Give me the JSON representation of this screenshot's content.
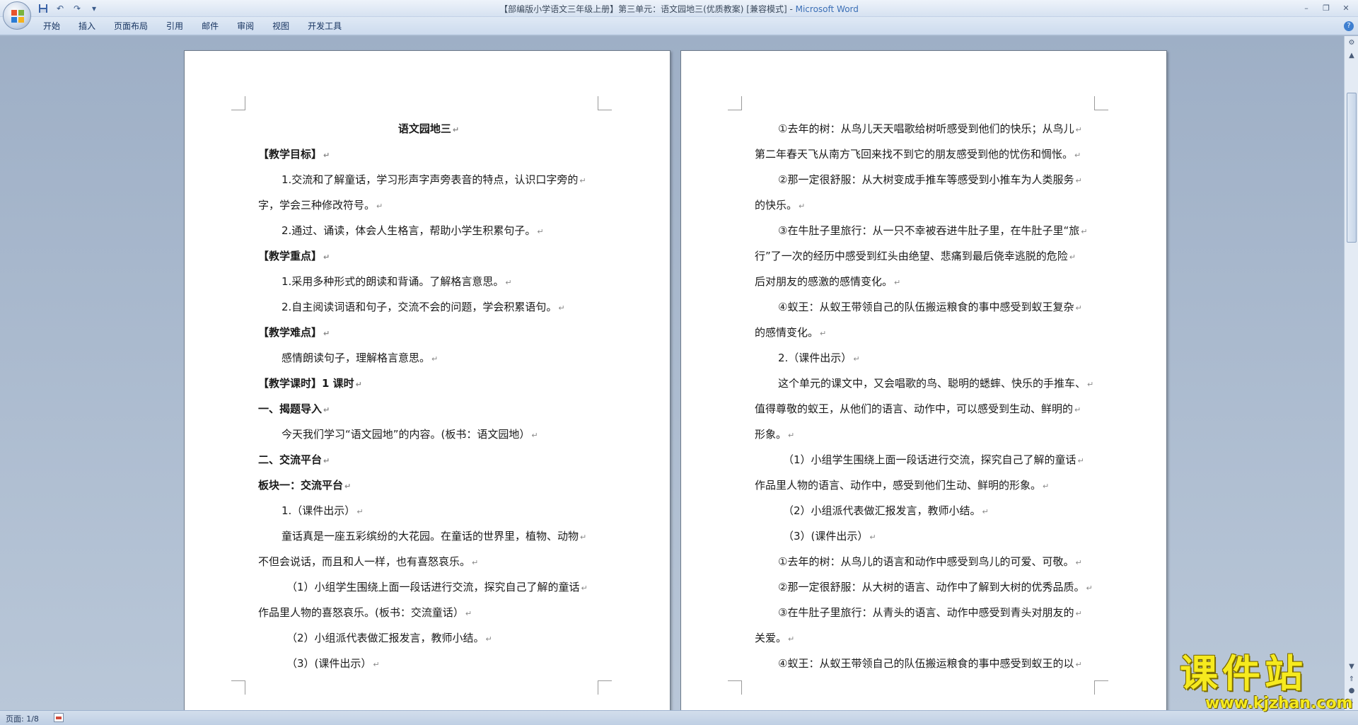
{
  "window": {
    "title_prefix": "【部编版小学语文三年级上册】第三单元：语文园地三(优质教案) [兼容模式] - ",
    "title_app": "Microsoft Word",
    "controls": [
      "minimize-icon",
      "restore-icon",
      "close-icon"
    ]
  },
  "quick_access": [
    "save-icon",
    "undo-icon",
    "redo-icon",
    "customize-icon"
  ],
  "ribbon": {
    "tabs": [
      "开始",
      "插入",
      "页面布局",
      "引用",
      "邮件",
      "审阅",
      "视图",
      "开发工具"
    ]
  },
  "pages": {
    "left": [
      {
        "text": "语文园地三",
        "style": "center bold"
      },
      {
        "text": "【教学目标】",
        "style": "bold"
      },
      {
        "text": "1.交流和了解童话，学习形声字声旁表音的特点，认识口字旁的",
        "style": "indent"
      },
      {
        "text": "字，学会三种修改符号。",
        "style": ""
      },
      {
        "text": "2.通过、诵读，体会人生格言，帮助小学生积累句子。",
        "style": "indent"
      },
      {
        "text": "【教学重点】",
        "style": "bold"
      },
      {
        "text": "1.采用多种形式的朗读和背诵。了解格言意思。",
        "style": "indent"
      },
      {
        "text": "2.自主阅读词语和句子，交流不会的问题，学会积累语句。",
        "style": "indent"
      },
      {
        "text": "【教学难点】",
        "style": "bold"
      },
      {
        "text": "感情朗读句子，理解格言意思。",
        "style": "indent"
      },
      {
        "text": "【教学课时】1 课时",
        "style": "bold"
      },
      {
        "text": "一、揭题导入",
        "style": "bold"
      },
      {
        "text": "今天我们学习“语文园地”的内容。(板书：语文园地）",
        "style": "indent"
      },
      {
        "text": "二、交流平台",
        "style": "bold"
      },
      {
        "text": "板块一：交流平台",
        "style": "bold"
      },
      {
        "text": "1.（课件出示）",
        "style": "indent"
      },
      {
        "text": "童话真是一座五彩缤纷的大花园。在童话的世界里，植物、动物",
        "style": "indent"
      },
      {
        "text": "不但会说话，而且和人一样，也有喜怒哀乐。",
        "style": ""
      },
      {
        "text": "（1）小组学生围绕上面一段话进行交流，探究自己了解的童话",
        "style": "indent2"
      },
      {
        "text": "作品里人物的喜怒哀乐。(板书：交流童话）",
        "style": ""
      },
      {
        "text": "（2）小组派代表做汇报发言，教师小结。",
        "style": "indent2"
      },
      {
        "text": "（3）(课件出示）",
        "style": "indent2"
      }
    ],
    "right": [
      {
        "text": "①去年的树：从鸟儿天天唱歌给树听感受到他们的快乐；从鸟儿",
        "style": "indent"
      },
      {
        "text": "第二年春天飞从南方飞回来找不到它的朋友感受到他的忧伤和惆怅。",
        "style": ""
      },
      {
        "text": "②那一定很舒服：从大树变成手推车等感受到小推车为人类服务",
        "style": "indent"
      },
      {
        "text": "的快乐。",
        "style": ""
      },
      {
        "text": "③在牛肚子里旅行：从一只不幸被吞进牛肚子里，在牛肚子里“旅",
        "style": "indent"
      },
      {
        "text": "行”了一次的经历中感受到红头由绝望、悲痛到最后侥幸逃脱的危险",
        "style": ""
      },
      {
        "text": "后对朋友的感激的感情变化。",
        "style": ""
      },
      {
        "text": "④蚁王：从蚁王带领自己的队伍搬运粮食的事中感受到蚁王复杂",
        "style": "indent"
      },
      {
        "text": "的感情变化。",
        "style": ""
      },
      {
        "text": "2.（课件出示）",
        "style": "indent"
      },
      {
        "text": "这个单元的课文中，又会唱歌的鸟、聪明的蟋蟀、快乐的手推车、",
        "style": "indent"
      },
      {
        "text": "值得尊敬的蚁王，从他们的语言、动作中，可以感受到生动、鲜明的",
        "style": ""
      },
      {
        "text": "形象。",
        "style": ""
      },
      {
        "text": "（1）小组学生围绕上面一段话进行交流，探究自己了解的童话",
        "style": "indent2"
      },
      {
        "text": "作品里人物的语言、动作中，感受到他们生动、鲜明的形象。",
        "style": ""
      },
      {
        "text": "（2）小组派代表做汇报发言，教师小结。",
        "style": "indent2"
      },
      {
        "text": "（3）(课件出示）",
        "style": "indent2"
      },
      {
        "text": "①去年的树：从鸟儿的语言和动作中感受到鸟儿的可爱、可敬。",
        "style": "indent"
      },
      {
        "text": "②那一定很舒服：从大树的语言、动作中了解到大树的优秀品质。",
        "style": "indent"
      },
      {
        "text": "③在牛肚子里旅行：从青头的语言、动作中感受到青头对朋友的",
        "style": "indent"
      },
      {
        "text": "关爱。",
        "style": ""
      },
      {
        "text": "④蚁王：从蚁王带领自己的队伍搬运粮食的事中感受到蚁王的以",
        "style": "indent"
      }
    ]
  },
  "paragraph_mark": "↵",
  "status": {
    "page_label": "页面: 1/8"
  },
  "watermark": {
    "cn": "课件站",
    "url": "www.kjzhan.com"
  },
  "colors": {
    "app_title": "#3b6fb6",
    "background": "#a8b8cc",
    "watermark": "#f6ea1e"
  }
}
